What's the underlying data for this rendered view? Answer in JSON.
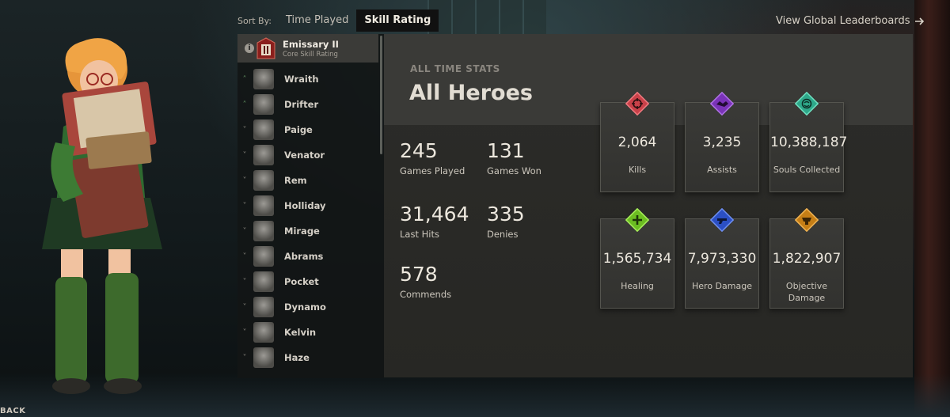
{
  "nav": {
    "back_label": "BACK"
  },
  "sort": {
    "label": "Sort By:",
    "tabs": [
      {
        "label": "Time Played",
        "active": false
      },
      {
        "label": "Skill Rating",
        "active": true
      }
    ]
  },
  "global_link": {
    "label": "View Global Leaderboards",
    "icon": "arrow-right-icon"
  },
  "rank": {
    "name": "Emissary II",
    "subtitle": "Core Skill Rating",
    "badge_numeral": "II",
    "info_icon": "info-icon"
  },
  "heroes": [
    {
      "name": "Wraith",
      "trend": "up"
    },
    {
      "name": "Drifter",
      "trend": "up"
    },
    {
      "name": "Paige",
      "trend": "down"
    },
    {
      "name": "Venator",
      "trend": "down"
    },
    {
      "name": "Rem",
      "trend": "down"
    },
    {
      "name": "Holliday",
      "trend": "down"
    },
    {
      "name": "Mirage",
      "trend": "down"
    },
    {
      "name": "Abrams",
      "trend": "down"
    },
    {
      "name": "Pocket",
      "trend": "down"
    },
    {
      "name": "Dynamo",
      "trend": "down"
    },
    {
      "name": "Kelvin",
      "trend": "down"
    },
    {
      "name": "Haze",
      "trend": "down"
    }
  ],
  "stats": {
    "kicker": "ALL TIME STATS",
    "title": "All Heroes",
    "games_played": {
      "value": "245",
      "label": "Games Played"
    },
    "games_won": {
      "value": "131",
      "label": "Games Won"
    },
    "last_hits": {
      "value": "31,464",
      "label": "Last Hits"
    },
    "denies": {
      "value": "335",
      "label": "Denies"
    },
    "commends": {
      "value": "578",
      "label": "Commends"
    }
  },
  "cards": {
    "kills": {
      "value": "2,064",
      "label": "Kills",
      "color": "#e0525a",
      "icon": "crosshair-icon"
    },
    "assists": {
      "value": "3,235",
      "label": "Assists",
      "color": "#8e3fd1",
      "icon": "handshake-icon"
    },
    "souls": {
      "value": "10,388,187",
      "label": "Souls Collected",
      "color": "#3fbf9e",
      "icon": "soul-orb-icon"
    },
    "healing": {
      "value": "1,565,734",
      "label": "Healing",
      "color": "#7fcf2b",
      "icon": "plus-icon"
    },
    "hero_damage": {
      "value": "7,973,330",
      "label": "Hero Damage",
      "color": "#2f58d6",
      "icon": "gun-icon"
    },
    "objective_damage": {
      "value": "1,822,907",
      "label": "Objective Damage",
      "color": "#d98f1f",
      "icon": "objective-icon"
    }
  }
}
